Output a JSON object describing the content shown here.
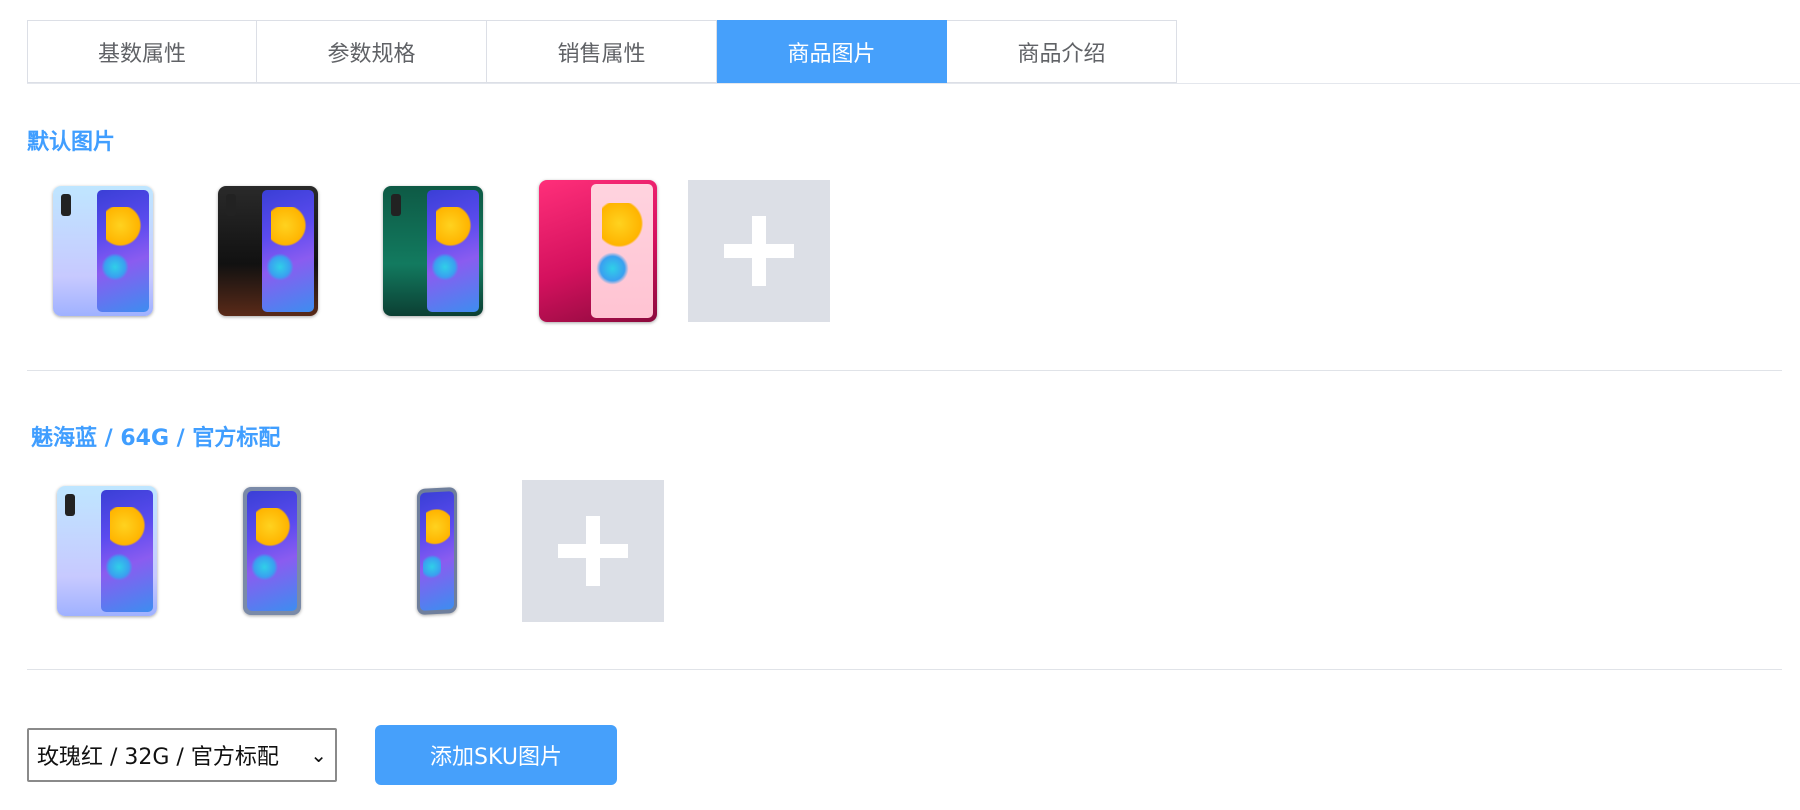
{
  "tabs": [
    {
      "label": "基数属性"
    },
    {
      "label": "参数规格"
    },
    {
      "label": "销售属性"
    },
    {
      "label": "商品图片"
    },
    {
      "label": "商品介绍"
    }
  ],
  "active_tab": "商品图片",
  "default_images": {
    "title": "默认图片",
    "images": [
      {
        "icon": "phone-image",
        "color": "light-blue"
      },
      {
        "icon": "phone-image",
        "color": "black"
      },
      {
        "icon": "phone-image",
        "color": "green"
      },
      {
        "icon": "phone-image",
        "color": "red"
      }
    ],
    "add_icon": "plus-icon"
  },
  "sku_section": {
    "title": "魅海蓝 / 64G / 官方标配",
    "images": [
      {
        "icon": "phone-image",
        "color": "light-blue"
      },
      {
        "icon": "phone-image",
        "color": "blue"
      },
      {
        "icon": "phone-image",
        "color": "blue"
      }
    ],
    "add_icon": "plus-icon"
  },
  "sku_select": {
    "value": "玫瑰红 / 32G / 官方标配"
  },
  "add_sku_button": {
    "label": "添加SKU图片"
  },
  "colors": {
    "accent": "#46a0fb",
    "title": "#409eff",
    "tile": "#dcdfe6"
  }
}
